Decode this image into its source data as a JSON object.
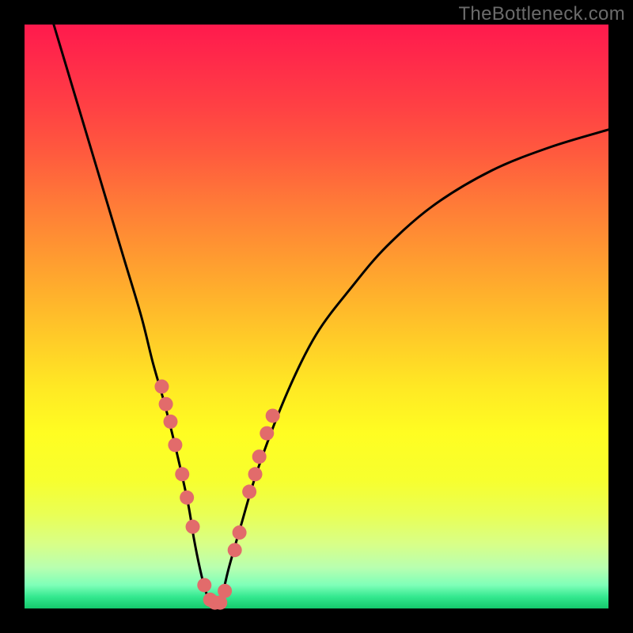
{
  "watermark": "TheBottleneck.com",
  "chart_data": {
    "type": "line",
    "title": "",
    "xlabel": "",
    "ylabel": "",
    "xlim": [
      0,
      100
    ],
    "ylim": [
      0,
      100
    ],
    "grid": false,
    "series": [
      {
        "name": "bottleneck-curve",
        "color": "#000000",
        "x": [
          5,
          8,
          11,
          14,
          17,
          20,
          22,
          24,
          26,
          28,
          29,
          30,
          31,
          32,
          33,
          34,
          35,
          37,
          40,
          45,
          50,
          56,
          62,
          70,
          80,
          90,
          100
        ],
        "y": [
          100,
          90,
          80,
          70,
          60,
          50,
          42,
          35,
          27,
          18,
          12,
          7,
          3,
          1,
          1,
          3,
          7,
          14,
          24,
          37,
          47,
          55,
          62,
          69,
          75,
          79,
          82
        ]
      }
    ],
    "markers": [
      {
        "name": "left-branch-dots",
        "color": "#e26b6b",
        "x": [
          23.5,
          24.2,
          25.0,
          25.8,
          27.0,
          27.8,
          28.8,
          30.8,
          31.8,
          32.6
        ],
        "y": [
          38,
          35,
          32,
          28,
          23,
          19,
          14,
          4,
          1.5,
          1
        ]
      },
      {
        "name": "right-branch-dots",
        "color": "#e26b6b",
        "x": [
          33.5,
          34.3,
          36.0,
          36.8,
          38.5,
          39.5,
          40.2,
          41.5,
          42.5
        ],
        "y": [
          1,
          3,
          10,
          13,
          20,
          23,
          26,
          30,
          33
        ]
      }
    ],
    "minimum_x": 32.5
  }
}
